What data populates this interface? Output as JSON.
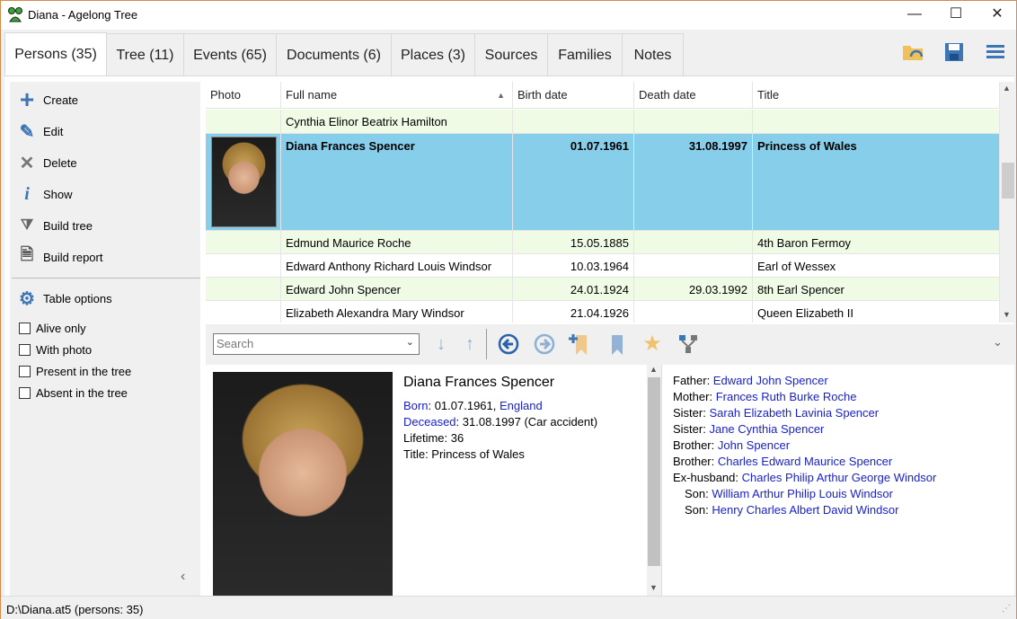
{
  "window": {
    "title": "Diana - Agelong Tree",
    "minimize": "—",
    "maximize": "☐",
    "close": "✕"
  },
  "tabs": [
    {
      "label": "Persons (35)"
    },
    {
      "label": "Tree (11)"
    },
    {
      "label": "Events (65)"
    },
    {
      "label": "Documents (6)"
    },
    {
      "label": "Places (3)"
    },
    {
      "label": "Sources"
    },
    {
      "label": "Families"
    },
    {
      "label": "Notes"
    }
  ],
  "sidebar": {
    "actions": [
      {
        "label": "Create",
        "icon": "plus-icon"
      },
      {
        "label": "Edit",
        "icon": "pencil-icon"
      },
      {
        "label": "Delete",
        "icon": "x-icon"
      },
      {
        "label": "Show",
        "icon": "info-icon"
      },
      {
        "label": "Build tree",
        "icon": "tree-icon"
      },
      {
        "label": "Build report",
        "icon": "report-icon"
      }
    ],
    "table_options": "Table options",
    "filters": [
      {
        "label": "Alive only",
        "checked": false
      },
      {
        "label": "With photo",
        "checked": false
      },
      {
        "label": "Present in the tree",
        "checked": false
      },
      {
        "label": "Absent in the tree",
        "checked": false
      }
    ],
    "collapse": "‹"
  },
  "grid": {
    "columns": [
      "Photo",
      "Full name",
      "Birth date",
      "Death date",
      "Title"
    ],
    "sort_column": "Full name",
    "sort_indicator": "▲",
    "rows": [
      {
        "name": "Cynthia Elinor Beatrix Hamilton",
        "birth": "",
        "death": "",
        "title": ""
      },
      {
        "name": "Diana Frances Spencer",
        "birth": "01.07.1961",
        "death": "31.08.1997",
        "title": "Princess of Wales",
        "selected": true,
        "photo": true
      },
      {
        "name": "Edmund Maurice Roche",
        "birth": "15.05.1885",
        "death": "",
        "title": "4th Baron Fermoy"
      },
      {
        "name": "Edward Anthony Richard Louis Windsor",
        "birth": "10.03.1964",
        "death": "",
        "title": "Earl of Wessex"
      },
      {
        "name": "Edward John Spencer",
        "birth": "24.01.1924",
        "death": "29.03.1992",
        "title": "8th Earl Spencer"
      },
      {
        "name": "Elizabeth Alexandra Mary Windsor",
        "birth": "21.04.1926",
        "death": "",
        "title": "Queen Elizabeth II"
      }
    ]
  },
  "toolbar": {
    "search_placeholder": "Search"
  },
  "detail": {
    "name": "Diana Frances Spencer",
    "born_label": "Born",
    "born": ": 01.07.1961, ",
    "born_place": "England",
    "deceased_label": "Deceased",
    "deceased": ": 31.08.1997 (Car accident)",
    "lifetime": "Lifetime: 36",
    "title": "Title: Princess of Wales"
  },
  "relatives": [
    {
      "rel": "Father: ",
      "name": "Edward John Spencer",
      "indent": false
    },
    {
      "rel": "Mother: ",
      "name": "Frances Ruth Burke Roche",
      "indent": false
    },
    {
      "rel": "Sister: ",
      "name": "Sarah Elizabeth Lavinia Spencer",
      "indent": false
    },
    {
      "rel": "Sister: ",
      "name": "Jane Cynthia Spencer",
      "indent": false
    },
    {
      "rel": "Brother: ",
      "name": "John Spencer",
      "indent": false
    },
    {
      "rel": "Brother: ",
      "name": "Charles Edward Maurice Spencer",
      "indent": false
    },
    {
      "rel": "Ex-husband: ",
      "name": "Charles Philip Arthur George Windsor",
      "indent": false
    },
    {
      "rel": "Son: ",
      "name": "William Arthur Philip Louis Windsor",
      "indent": true
    },
    {
      "rel": "Son: ",
      "name": "Henry Charles Albert David Windsor",
      "indent": true
    }
  ],
  "status": "D:\\Diana.at5 (persons: 35)",
  "colors": {
    "selected_row": "#87ceeb",
    "alt_row": "#f0fbe6",
    "link": "#1a22c9",
    "accent": "#3d76b5"
  }
}
